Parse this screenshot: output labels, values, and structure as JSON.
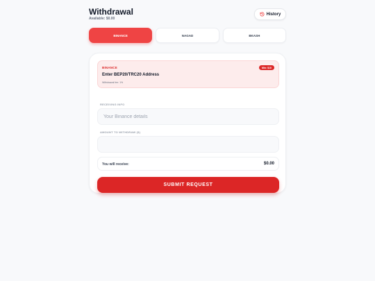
{
  "header": {
    "title": "Withdrawal",
    "available": "Available: $0.00",
    "history_label": "History",
    "history_icon": "history-icon"
  },
  "tabs": [
    {
      "label": "BINANCE",
      "active": true
    },
    {
      "label": "NAGAD",
      "active": false
    },
    {
      "label": "BKASH",
      "active": false
    }
  ],
  "info": {
    "method": "BINANCE",
    "badge": "Min: $10",
    "heading": "Enter BEP20/TRC20 Address",
    "fee": "Withdrawal fee: 1%"
  },
  "form": {
    "receiving_label": "RECEIVING INFO",
    "receiving_placeholder": "Your Binance details",
    "receiving_value": "",
    "amount_label": "AMOUNT TO WITHDRAW ($)",
    "amount_placeholder": "",
    "amount_value": ""
  },
  "receive": {
    "label": "You will receive:",
    "amount": "$0.00"
  },
  "submit_label": "SUBMIT REQUEST",
  "colors": {
    "accent": "#dc2626",
    "accent_light": "#ef4444",
    "info_bg": "#fdecec",
    "page_bg": "#f8f9fb"
  }
}
